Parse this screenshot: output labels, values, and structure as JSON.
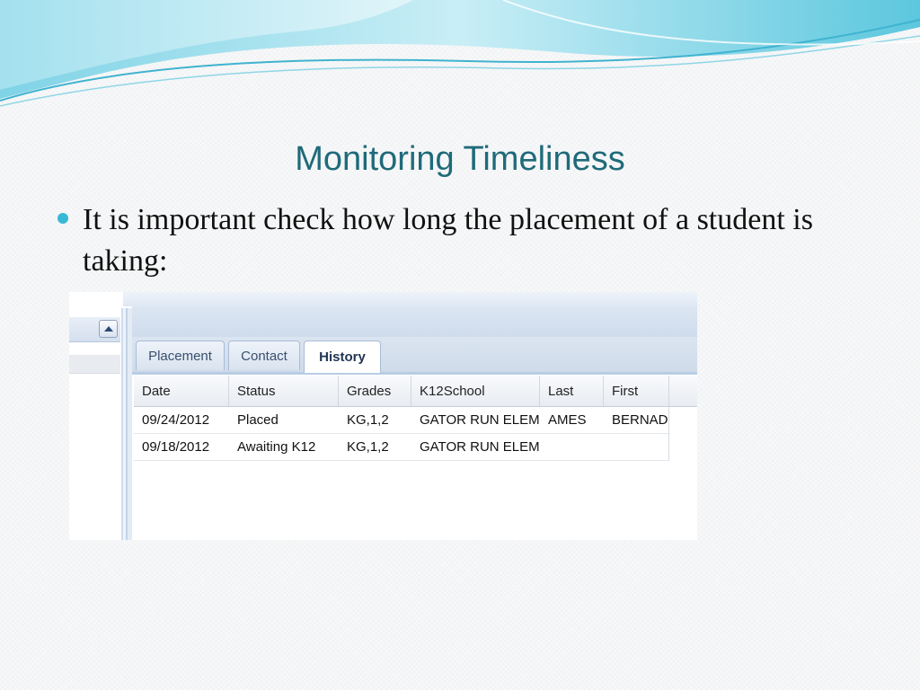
{
  "slide": {
    "title": "Monitoring Timeliness",
    "bullet": "It is important check how long the placement of a student is taking:"
  },
  "app": {
    "tabs": [
      {
        "label": "Placement",
        "active": false
      },
      {
        "label": "Contact",
        "active": false
      },
      {
        "label": "History",
        "active": true
      }
    ],
    "columns": [
      "Date",
      "Status",
      "Grades",
      "K12School",
      "Last",
      "First"
    ],
    "rows": [
      [
        "09/24/2012",
        "Placed",
        "KG,1,2",
        "GATOR RUN ELEM",
        "AMES",
        "BERNAD"
      ],
      [
        "09/18/2012",
        "Awaiting K12",
        "KG,1,2",
        "GATOR RUN ELEM",
        "",
        ""
      ]
    ]
  },
  "colors": {
    "title": "#1f6a7a",
    "bullet": "#37b8d6",
    "wave_light": "#bfe9f3",
    "wave_dark": "#4bbfd8"
  }
}
